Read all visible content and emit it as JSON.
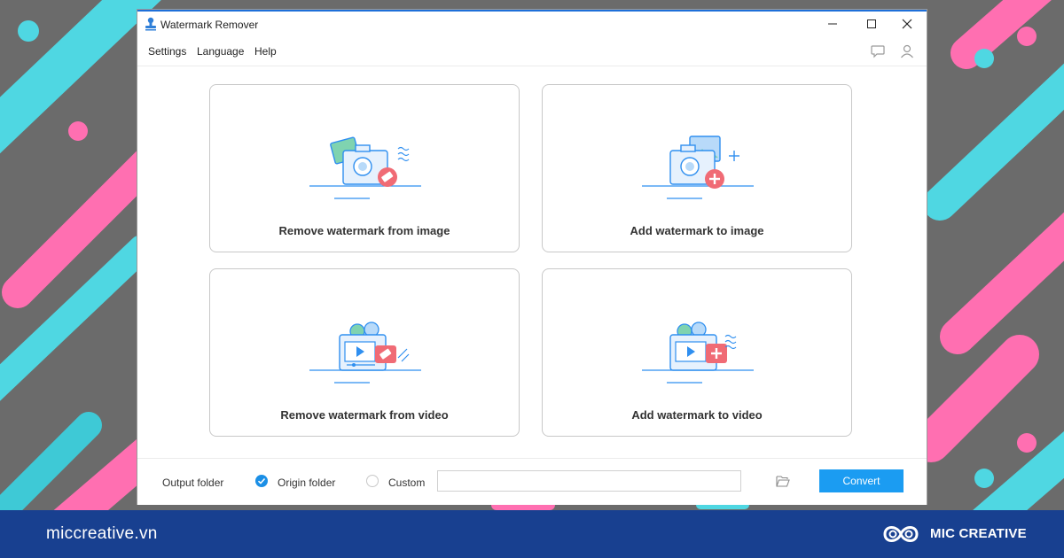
{
  "window": {
    "title": "Watermark Remover"
  },
  "menu": {
    "items": [
      "Settings",
      "Language",
      "Help"
    ]
  },
  "cards": [
    {
      "label": "Remove watermark from image",
      "icon": "camera-eraser-icon"
    },
    {
      "label": "Add watermark to image",
      "icon": "camera-plus-icon"
    },
    {
      "label": "Remove watermark from video",
      "icon": "video-eraser-icon"
    },
    {
      "label": "Add watermark to video",
      "icon": "video-plus-icon"
    }
  ],
  "bottom": {
    "output_label": "Output folder",
    "origin_label": "Origin folder",
    "custom_label": "Custom",
    "path_value": "",
    "convert_label": "Convert",
    "selected_option": "Origin folder"
  },
  "footer": {
    "url": "miccreative.vn",
    "brand": "MIC CREATIVE"
  },
  "colors": {
    "accent": "#1b9cf2",
    "footer": "#184090",
    "icon_blue": "#2f8ff0",
    "icon_red": "#f06b75"
  }
}
